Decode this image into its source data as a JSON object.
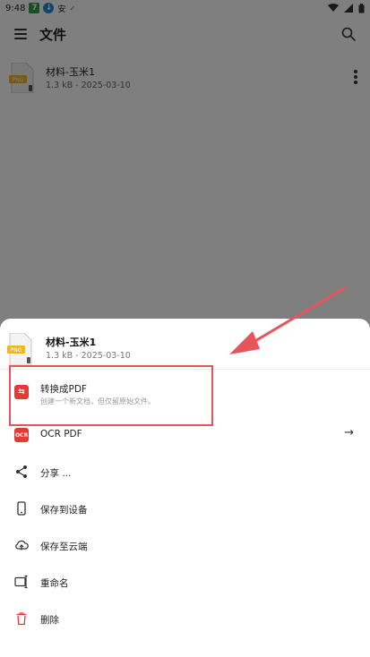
{
  "status_bar": {
    "time": "9:48",
    "badges": [
      "7",
      "↓",
      "安",
      "✓"
    ]
  },
  "app_bar": {
    "title": "文件"
  },
  "file_list": [
    {
      "name": "材料-玉米1",
      "meta": "1.3 kB - 2025-03-10",
      "thumb_label": "PNG"
    }
  ],
  "sheet": {
    "file": {
      "name": "材料-玉米1",
      "meta": "1.3 kB - 2025-03-10",
      "thumb_label": "PNG"
    },
    "items": [
      {
        "label": "转换成PDF",
        "sub": "创建一个新文档，但仅留原始文件。",
        "icon": "convert-pdf-icon"
      },
      {
        "label": "OCR PDF",
        "icon": "ocr-icon",
        "badge": "OCR",
        "trailing": "→"
      },
      {
        "label": "分享 ...",
        "icon": "share-icon"
      },
      {
        "label": "保存到设备",
        "icon": "phone-icon"
      },
      {
        "label": "保存至云端",
        "icon": "cloud-upload-icon"
      },
      {
        "label": "重命名",
        "icon": "rename-icon"
      },
      {
        "label": "删除",
        "icon": "trash-icon"
      }
    ]
  },
  "colors": {
    "accent_red": "#e53935",
    "annotation_red": "#e8545b"
  }
}
